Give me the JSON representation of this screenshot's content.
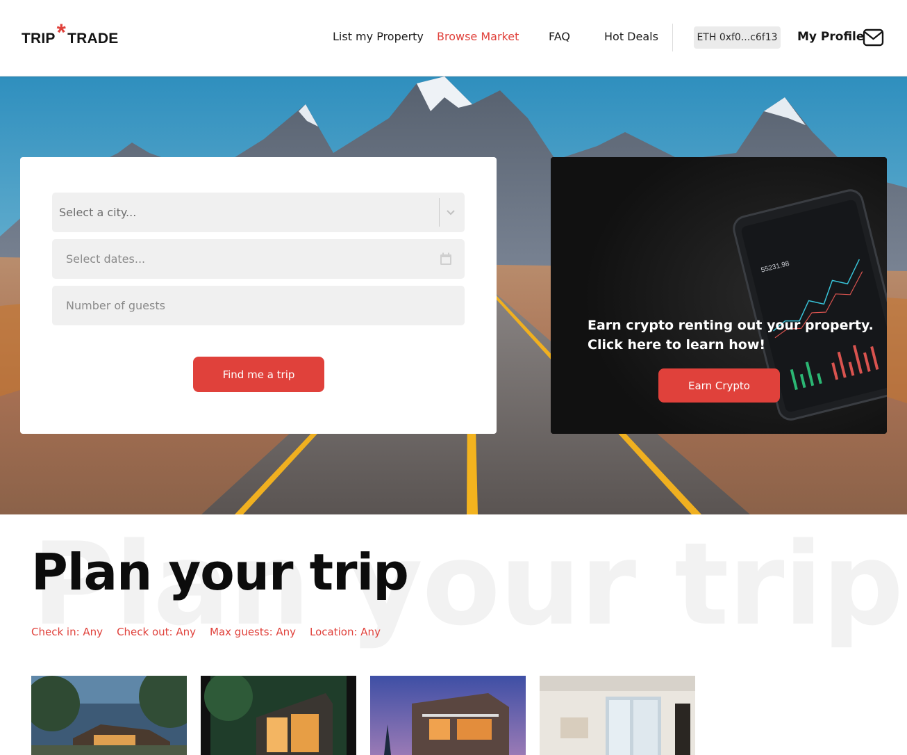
{
  "brand": {
    "left": "TRIP",
    "star": "*",
    "right": "TRADE"
  },
  "nav": {
    "list_property": "List my Property",
    "browse_market": "Browse Market",
    "faq": "FAQ",
    "hot_deals": "Hot Deals"
  },
  "wallet": {
    "label": "ETH 0xf0...c6f13"
  },
  "profile": {
    "label": "My Profile"
  },
  "search": {
    "city_placeholder": "Select a city...",
    "dates_placeholder": "Select dates...",
    "guests_placeholder": "Number of guests",
    "submit_label": "Find me a trip"
  },
  "promo": {
    "text_line1": "Earn crypto renting out your property.",
    "text_line2": "Click here to learn how!",
    "button_label": "Earn Crypto",
    "phone_price": "55231.98"
  },
  "plan": {
    "background_text": "Plan your trip",
    "title": "Plan your trip",
    "filters": [
      "Check in: Any",
      "Check out: Any",
      "Max guests: Any",
      "Location: Any"
    ]
  },
  "colors": {
    "accent": "#e0413b",
    "field_bg": "#f0f0f0",
    "promo_bg": "#141414"
  },
  "icons": [
    "chevron-down-icon",
    "calendar-icon",
    "mail-icon"
  ]
}
